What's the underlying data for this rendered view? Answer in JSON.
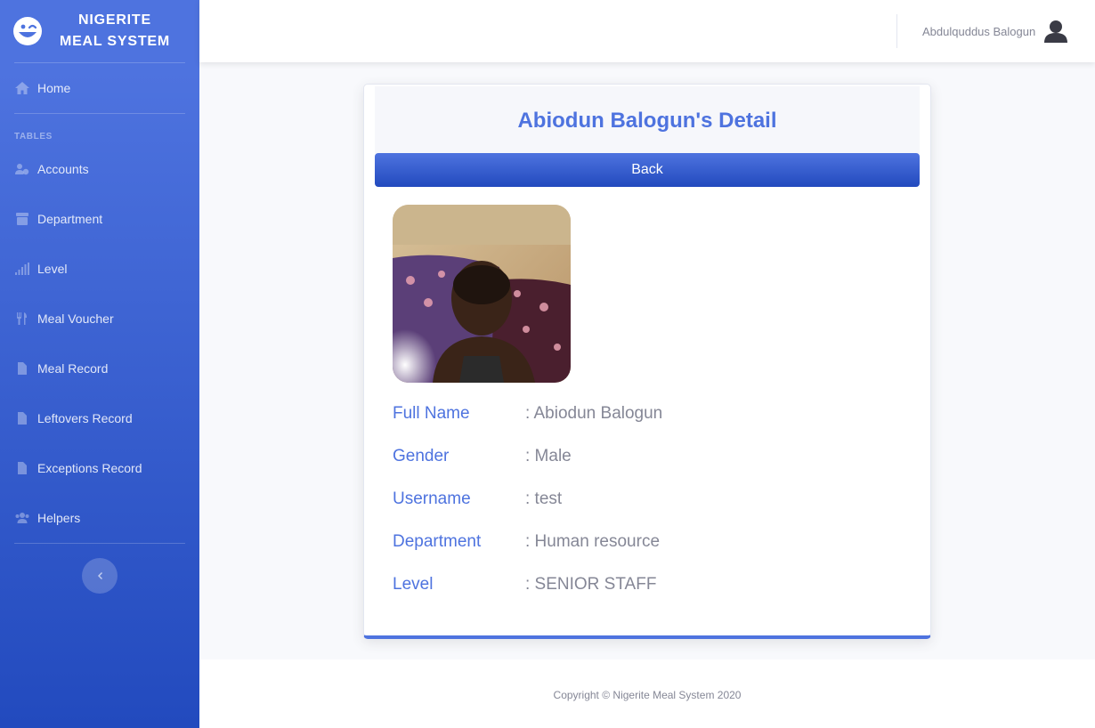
{
  "brand": {
    "line1": "NIGERITE",
    "line2": "MEAL SYSTEM",
    "icon": "laugh-wink-icon"
  },
  "sidebar": {
    "home": {
      "label": "Home",
      "icon": "home-icon"
    },
    "heading": "TABLES",
    "items": [
      {
        "label": "Accounts",
        "icon": "users-cog-icon"
      },
      {
        "label": "Department",
        "icon": "archive-icon"
      },
      {
        "label": "Level",
        "icon": "signal-icon"
      },
      {
        "label": "Meal Voucher",
        "icon": "utensils-icon"
      },
      {
        "label": "Meal Record",
        "icon": "file-icon"
      },
      {
        "label": "Leftovers Record",
        "icon": "file-alt-icon"
      },
      {
        "label": "Exceptions Record",
        "icon": "file-alt-icon"
      },
      {
        "label": "Helpers",
        "icon": "users-icon"
      }
    ],
    "toggle_icon": "chevron-left-icon"
  },
  "topbar": {
    "user_name": "Abdulquddus Balogun",
    "avatar_icon": "user-icon"
  },
  "card": {
    "title": "Abiodun Balogun's Detail",
    "back_label": "Back",
    "details": [
      {
        "label": "Full Name",
        "value": ": Abiodun Balogun"
      },
      {
        "label": "Gender",
        "value": ": Male"
      },
      {
        "label": "Username",
        "value": ": test"
      },
      {
        "label": "Department",
        "value": ": Human resource"
      },
      {
        "label": "Level",
        "value": ": SENIOR STAFF"
      }
    ]
  },
  "footer": {
    "text": "Copyright © Nigerite Meal System 2020"
  },
  "colors": {
    "primary": "#4e73df",
    "primary_dark": "#224abe",
    "muted_text": "#858796",
    "page_bg": "#f8f9fc"
  }
}
